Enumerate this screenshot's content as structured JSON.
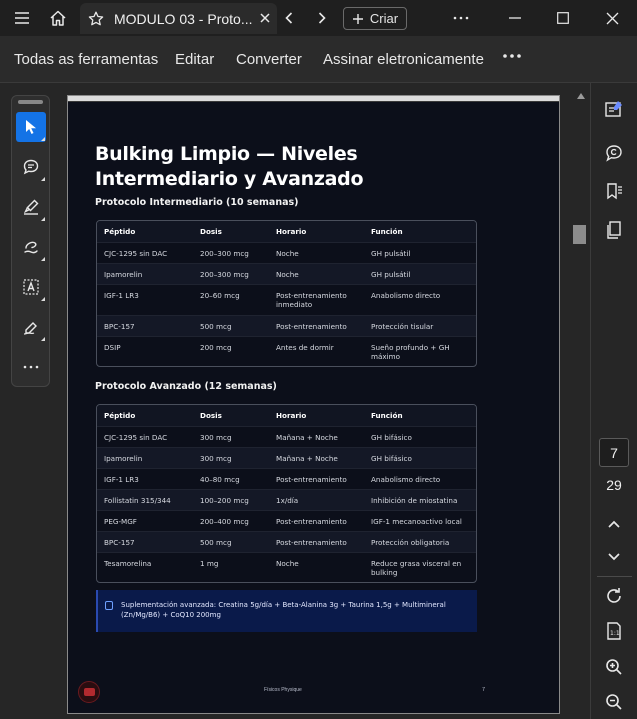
{
  "window": {
    "tab_title": "MODULO 03 - Proto...",
    "new_tab_label": "Criar"
  },
  "menubar": {
    "items": [
      "Todas as ferramentas",
      "Editar",
      "Converter",
      "Assinar eletronicamente"
    ]
  },
  "document": {
    "heading": "Bulking Limpio — Niveles Intermediario y Avanzado",
    "intermediate": {
      "title": "Protocolo Intermediario (10 semanas)",
      "columns": [
        "Péptido",
        "Dosis",
        "Horario",
        "Función"
      ],
      "rows": [
        [
          "CJC-1295 sin DAC",
          "200–300 mcg",
          "Noche",
          "GH pulsátil"
        ],
        [
          "Ipamorelin",
          "200–300 mcg",
          "Noche",
          "GH pulsátil"
        ],
        [
          "IGF-1 LR3",
          "20–60 mcg",
          "Post-entrenamiento inmediato",
          "Anabolismo directo"
        ],
        [
          "BPC-157",
          "500 mcg",
          "Post-entrenamiento",
          "Protección tisular"
        ],
        [
          "DSIP",
          "200 mcg",
          "Antes de dormir",
          "Sueño profundo + GH máximo"
        ]
      ]
    },
    "advanced": {
      "title": "Protocolo Avanzado (12 semanas)",
      "columns": [
        "Péptido",
        "Dosis",
        "Horario",
        "Función"
      ],
      "rows": [
        [
          "CJC-1295 sin DAC",
          "300 mcg",
          "Mañana + Noche",
          "GH bifásico"
        ],
        [
          "Ipamorelin",
          "300 mcg",
          "Mañana + Noche",
          "GH bifásico"
        ],
        [
          "IGF-1 LR3",
          "40–80 mcg",
          "Post-entrenamiento",
          "Anabolismo directo"
        ],
        [
          "Follistatin 315/344",
          "100–200 mcg",
          "1x/día",
          "Inhibición de miostatina"
        ],
        [
          "PEG-MGF",
          "200–400 mcg",
          "Post-entrenamiento",
          "IGF-1 mecanoactivo local"
        ],
        [
          "BPC-157",
          "500 mcg",
          "Post-entrenamiento",
          "Protección obligatoria"
        ],
        [
          "Tesamorelina",
          "1 mg",
          "Noche",
          "Reduce grasa visceral en bulking"
        ]
      ]
    },
    "note": "Suplementación avanzada: Creatina 5g/día + Beta-Alanina 3g + Taurina 1,5g + Multimineral (Zn/Mg/B6) + CoQ10 200mg",
    "footer_text": "Físicos Physique",
    "footer_page": "7"
  },
  "pager": {
    "current": "7",
    "total": "29"
  }
}
